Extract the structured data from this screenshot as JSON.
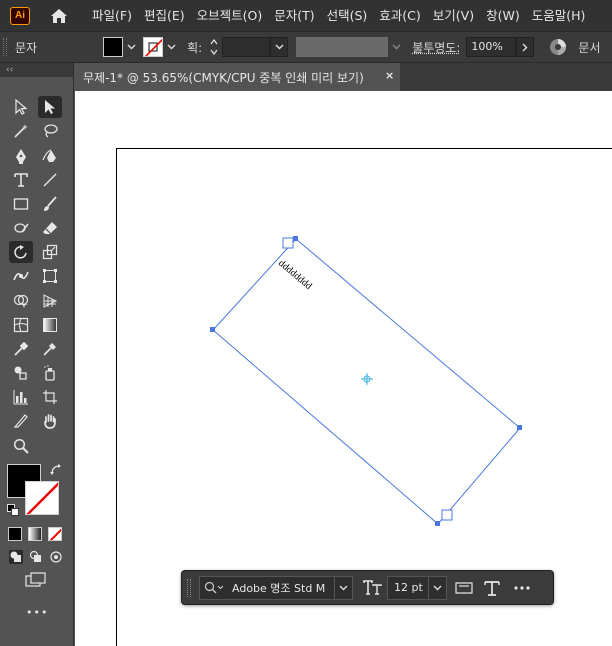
{
  "app": {
    "logo": "Ai"
  },
  "menu": [
    "파일(F)",
    "편집(E)",
    "오브젝트(O)",
    "문자(T)",
    "선택(S)",
    "효과(C)",
    "보기(V)",
    "창(W)",
    "도움말(H)"
  ],
  "control": {
    "type_label": "문자",
    "stroke_label": "획:",
    "opacity_label": "불투명도:",
    "opacity_value": "100%",
    "doc_label": "문서"
  },
  "tab": {
    "title": "무제-1* @ 53.65%(CMYK/CPU 중복 인쇄 미리 보기)",
    "close": "×"
  },
  "canvas": {
    "text_content": "dddddddd"
  },
  "taskbar": {
    "font_name": "Adobe 명조 Std M",
    "font_size": "12 pt"
  },
  "toolbar": {
    "collapse": "‹‹",
    "more": "•••"
  },
  "colors": {
    "fill": "#000000",
    "stroke": "none",
    "selection": "#4a78e0"
  },
  "icons": [
    "home-icon",
    "selection-tool-icon",
    "direct-selection-tool-icon",
    "magic-wand-icon",
    "lasso-icon",
    "pen-icon",
    "curvature-icon",
    "type-tool-icon",
    "line-tool-icon",
    "rectangle-tool-icon",
    "paintbrush-icon",
    "shaper-icon",
    "eraser-icon",
    "rotate-tool-icon",
    "scale-tool-icon",
    "hand-icon",
    "zoom-icon"
  ]
}
